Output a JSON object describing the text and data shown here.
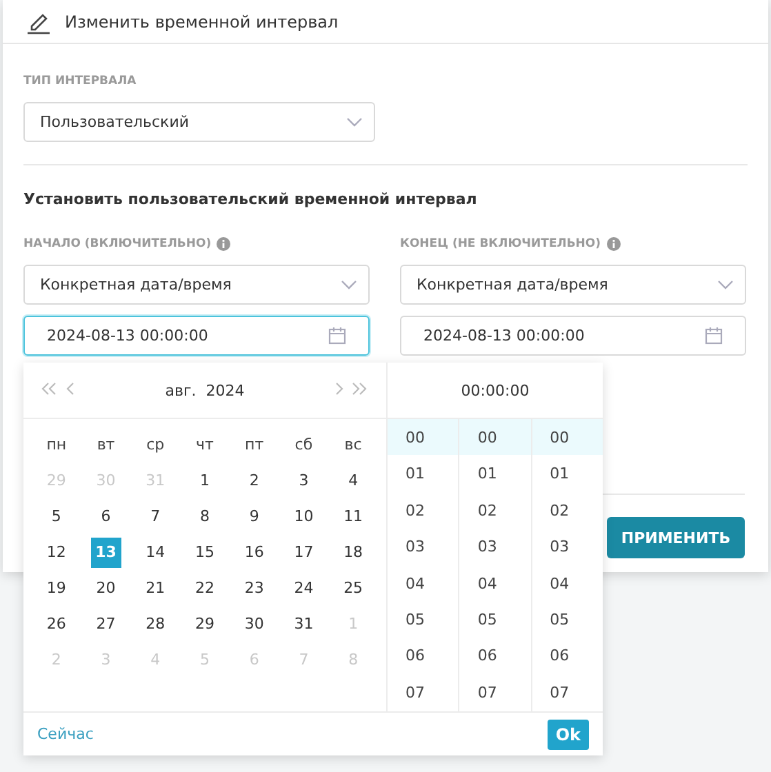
{
  "dialog": {
    "title": "Изменить временной интервал"
  },
  "interval_type": {
    "label": "ТИП ИНТЕРВАЛА",
    "value": "Пользовательский"
  },
  "custom_section": {
    "heading": "Установить пользовательский временной интервал"
  },
  "start": {
    "label": "НАЧАЛО (ВКЛЮЧИТЕЛЬНО)",
    "mode": "Конкретная дата/время",
    "value": "2024-08-13 00:00:00",
    "focused": true
  },
  "end": {
    "label": "КОНЕЦ (НЕ ВКЛЮЧИТЕЛЬНО)",
    "mode": "Конкретная дата/время",
    "value": "2024-08-13 00:00:00",
    "focused": false
  },
  "apply_button": "ПРИМЕНИТЬ",
  "picker": {
    "month_label": "авг.  2024",
    "weekdays": [
      "пн",
      "вт",
      "ср",
      "чт",
      "пт",
      "сб",
      "вс"
    ],
    "weeks": [
      [
        {
          "text": "29",
          "dimmed": true,
          "selected": false
        },
        {
          "text": "30",
          "dimmed": true,
          "selected": false
        },
        {
          "text": "31",
          "dimmed": true,
          "selected": false
        },
        {
          "text": "1",
          "dimmed": false,
          "selected": false
        },
        {
          "text": "2",
          "dimmed": false,
          "selected": false
        },
        {
          "text": "3",
          "dimmed": false,
          "selected": false
        },
        {
          "text": "4",
          "dimmed": false,
          "selected": false
        }
      ],
      [
        {
          "text": "5",
          "dimmed": false,
          "selected": false
        },
        {
          "text": "6",
          "dimmed": false,
          "selected": false
        },
        {
          "text": "7",
          "dimmed": false,
          "selected": false
        },
        {
          "text": "8",
          "dimmed": false,
          "selected": false
        },
        {
          "text": "9",
          "dimmed": false,
          "selected": false
        },
        {
          "text": "10",
          "dimmed": false,
          "selected": false
        },
        {
          "text": "11",
          "dimmed": false,
          "selected": false
        }
      ],
      [
        {
          "text": "12",
          "dimmed": false,
          "selected": false
        },
        {
          "text": "13",
          "dimmed": false,
          "selected": true
        },
        {
          "text": "14",
          "dimmed": false,
          "selected": false
        },
        {
          "text": "15",
          "dimmed": false,
          "selected": false
        },
        {
          "text": "16",
          "dimmed": false,
          "selected": false
        },
        {
          "text": "17",
          "dimmed": false,
          "selected": false
        },
        {
          "text": "18",
          "dimmed": false,
          "selected": false
        }
      ],
      [
        {
          "text": "19",
          "dimmed": false,
          "selected": false
        },
        {
          "text": "20",
          "dimmed": false,
          "selected": false
        },
        {
          "text": "21",
          "dimmed": false,
          "selected": false
        },
        {
          "text": "22",
          "dimmed": false,
          "selected": false
        },
        {
          "text": "23",
          "dimmed": false,
          "selected": false
        },
        {
          "text": "24",
          "dimmed": false,
          "selected": false
        },
        {
          "text": "25",
          "dimmed": false,
          "selected": false
        }
      ],
      [
        {
          "text": "26",
          "dimmed": false,
          "selected": false
        },
        {
          "text": "27",
          "dimmed": false,
          "selected": false
        },
        {
          "text": "28",
          "dimmed": false,
          "selected": false
        },
        {
          "text": "29",
          "dimmed": false,
          "selected": false
        },
        {
          "text": "30",
          "dimmed": false,
          "selected": false
        },
        {
          "text": "31",
          "dimmed": false,
          "selected": false
        },
        {
          "text": "1",
          "dimmed": true,
          "selected": false
        }
      ],
      [
        {
          "text": "2",
          "dimmed": true,
          "selected": false
        },
        {
          "text": "3",
          "dimmed": true,
          "selected": false
        },
        {
          "text": "4",
          "dimmed": true,
          "selected": false
        },
        {
          "text": "5",
          "dimmed": true,
          "selected": false
        },
        {
          "text": "6",
          "dimmed": true,
          "selected": false
        },
        {
          "text": "7",
          "dimmed": true,
          "selected": false
        },
        {
          "text": "8",
          "dimmed": true,
          "selected": false
        }
      ]
    ],
    "now_link": "Сейчас",
    "time_label": "00:00:00",
    "time_columns": [
      [
        {
          "text": "00",
          "selected": true
        },
        {
          "text": "01",
          "selected": false
        },
        {
          "text": "02",
          "selected": false
        },
        {
          "text": "03",
          "selected": false
        },
        {
          "text": "04",
          "selected": false
        },
        {
          "text": "05",
          "selected": false
        },
        {
          "text": "06",
          "selected": false
        },
        {
          "text": "07",
          "selected": false
        }
      ],
      [
        {
          "text": "00",
          "selected": true
        },
        {
          "text": "01",
          "selected": false
        },
        {
          "text": "02",
          "selected": false
        },
        {
          "text": "03",
          "selected": false
        },
        {
          "text": "04",
          "selected": false
        },
        {
          "text": "05",
          "selected": false
        },
        {
          "text": "06",
          "selected": false
        },
        {
          "text": "07",
          "selected": false
        }
      ],
      [
        {
          "text": "00",
          "selected": true
        },
        {
          "text": "01",
          "selected": false
        },
        {
          "text": "02",
          "selected": false
        },
        {
          "text": "03",
          "selected": false
        },
        {
          "text": "04",
          "selected": false
        },
        {
          "text": "05",
          "selected": false
        },
        {
          "text": "06",
          "selected": false
        },
        {
          "text": "07",
          "selected": false
        }
      ]
    ],
    "ok_button": "Ok"
  }
}
